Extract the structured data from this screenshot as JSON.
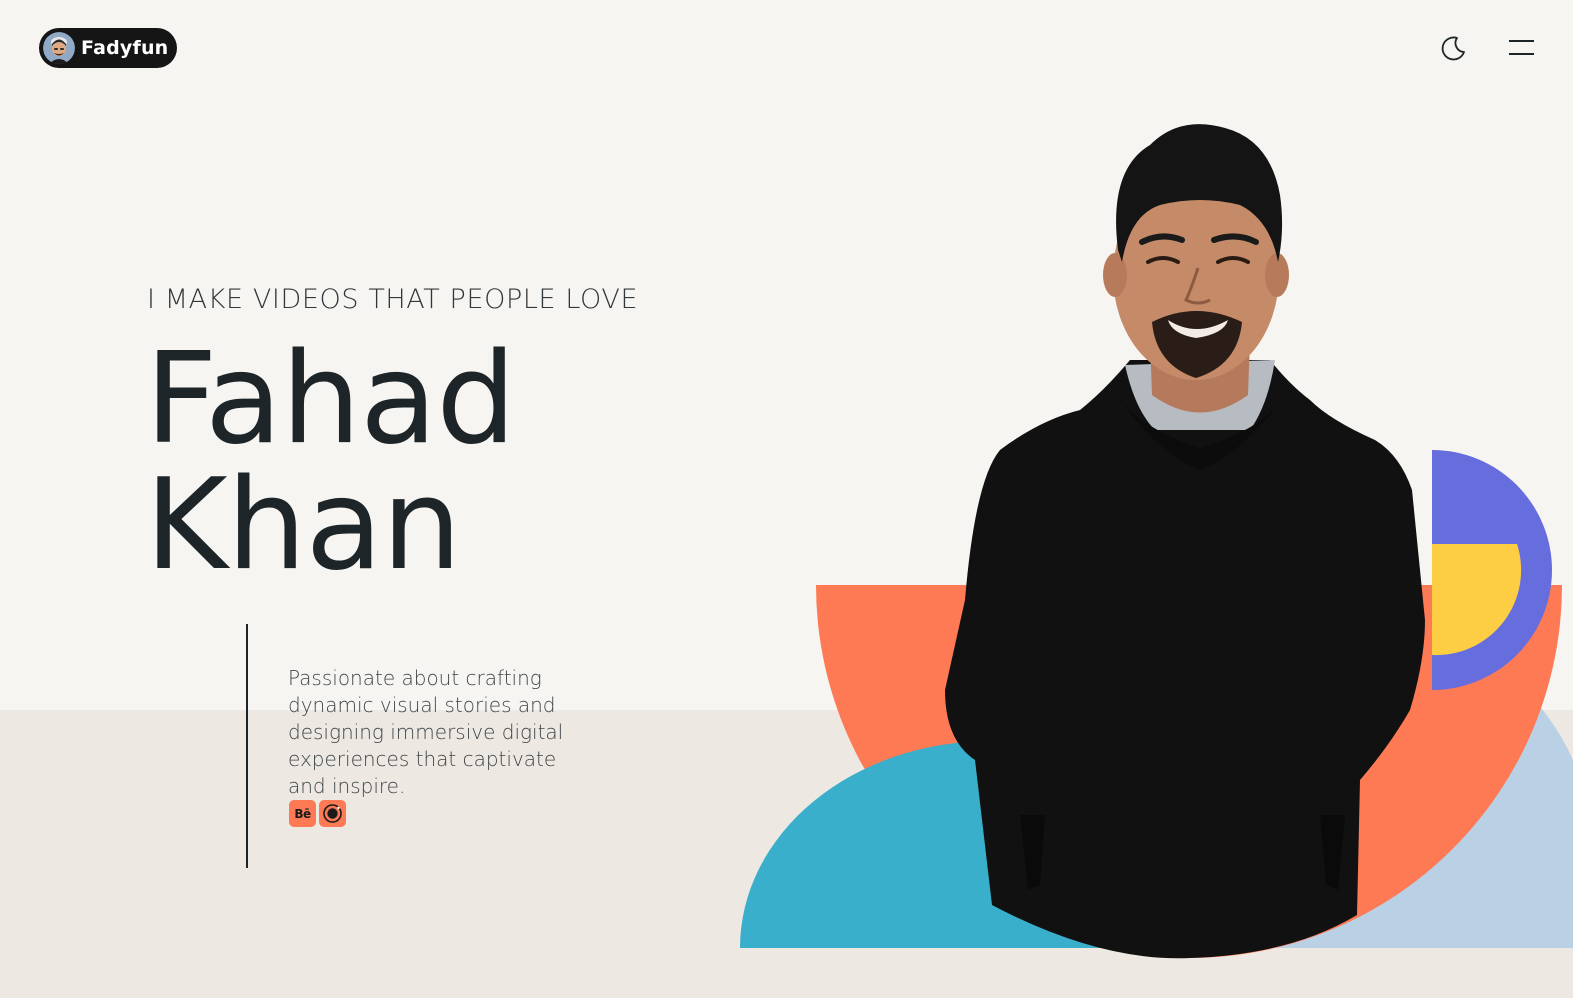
{
  "header": {
    "brand": "Fadyfun",
    "theme_toggle_icon": "moon-icon",
    "menu_icon": "hamburger-icon"
  },
  "hero": {
    "tagline": "I MAKE VIDEOS THAT PEOPLE LOVE",
    "name_first": "Fahad",
    "name_last": "Khan",
    "description": "Passionate about crafting dynamic visual stories and designing immersive digital experiences that captivate and inspire."
  },
  "social": [
    {
      "name": "behance",
      "label": "Bē",
      "icon": "behance-icon"
    },
    {
      "name": "dribbble",
      "label": "",
      "icon": "dribbble-icon"
    }
  ],
  "colors": {
    "background": "#f7f5f2",
    "band": "#ede8e2",
    "coral": "#fd7a55",
    "teal": "#3aafcb",
    "blue_light": "#b9d0e5",
    "purple": "#666ddd",
    "yellow": "#fdcd43",
    "ink": "#1d2528"
  }
}
